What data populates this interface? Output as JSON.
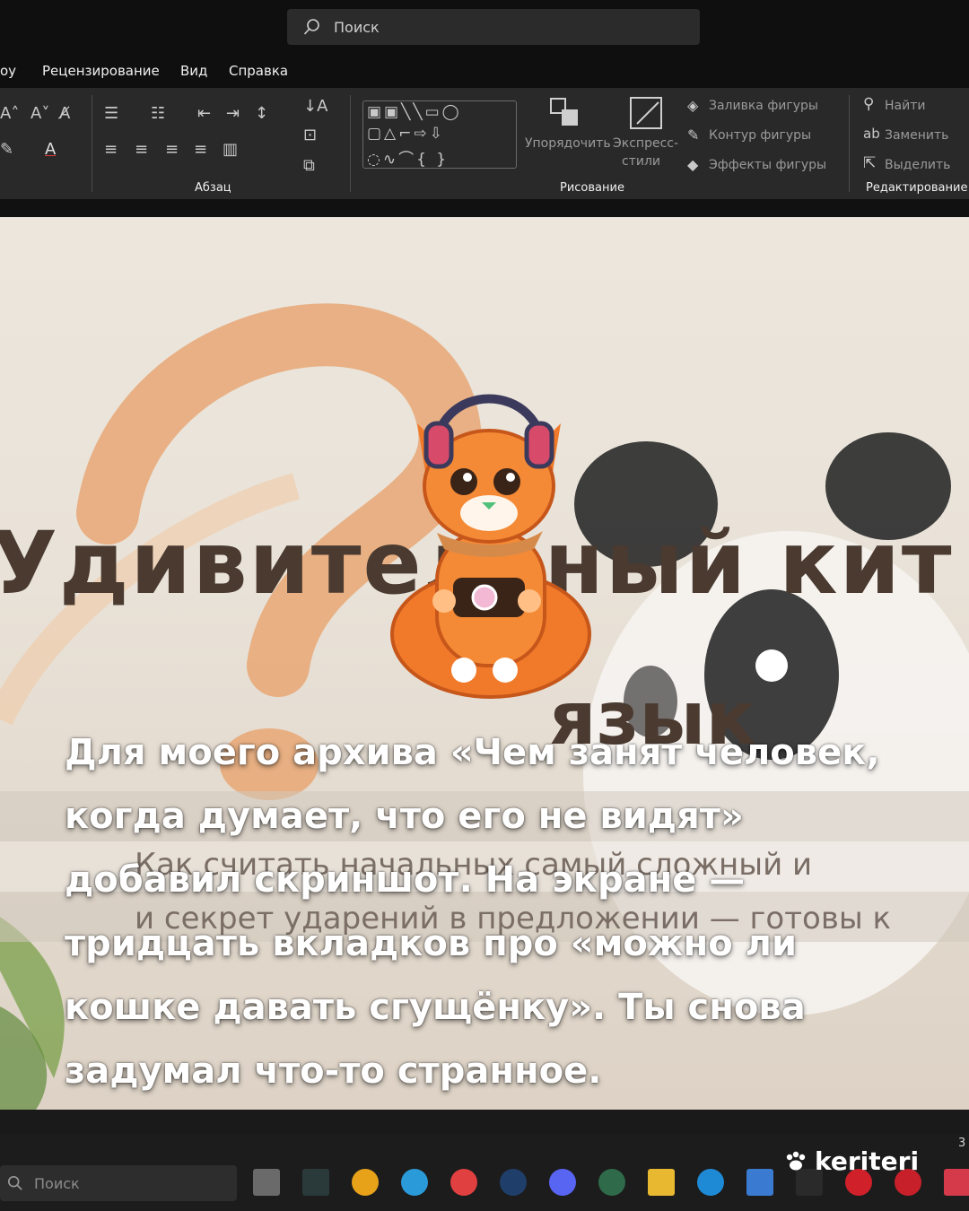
{
  "titlebar": {
    "search_placeholder": "Поиск"
  },
  "menu": {
    "items": [
      "оу",
      "Рецензирование",
      "Вид",
      "Справка"
    ]
  },
  "ribbon": {
    "groups": {
      "paragraph": "Абзац",
      "drawing": "Рисование",
      "editing": "Редактирование"
    },
    "drawing": {
      "arrange": "Упорядочить",
      "quick_styles_1": "Экспресс-",
      "quick_styles_2": "стили",
      "shape_fill": "Заливка фигуры",
      "shape_outline": "Контур фигуры",
      "shape_effects": "Эффекты фигуры"
    },
    "editing": {
      "find": "Найти",
      "replace": "Заменить",
      "select": "Выделить"
    }
  },
  "slide": {
    "title": "Удивительный кит",
    "subtitle": "язык",
    "line1": "Как считать начальных самый сложный и",
    "line2": "и секрет ударений в предложении — готовы к"
  },
  "caption": {
    "lines": [
      "Для моего архива «Чем занят человек,",
      "когда думает, что его не видят»",
      "добавил скриншот. На экране —",
      "тридцать вкладков про «можно ли",
      "кошке давать сгущёнку». Ты снова",
      "задумал что-то странное."
    ]
  },
  "taskbar": {
    "search_placeholder": "Поиск",
    "corner_text": "3"
  },
  "watermark": {
    "text": "keriteri"
  },
  "colors": {
    "accent_orange": "#f07a2a",
    "title_brown": "#4a3a30",
    "ribbon_bg": "#292929"
  }
}
